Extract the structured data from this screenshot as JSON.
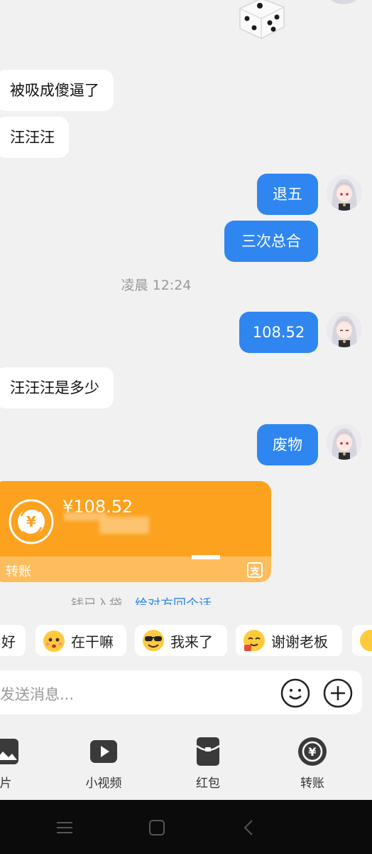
{
  "messages": [
    {
      "side": "left",
      "text": "被吸成傻逼了"
    },
    {
      "side": "left",
      "text": "汪汪汪"
    },
    {
      "side": "right",
      "text": "退五"
    },
    {
      "side": "right",
      "text": "三次总合"
    },
    {
      "side": "right",
      "text": "108.52"
    },
    {
      "side": "left",
      "text": "汪汪汪是多少"
    },
    {
      "side": "right",
      "text": "废物"
    }
  ],
  "timestamp": "凌晨 12:24",
  "transfer": {
    "amount": "¥108.52",
    "label": "转账",
    "received_text": "钱已入袋",
    "received_link": "给对方回个话"
  },
  "quick_replies": [
    {
      "label": "好",
      "icon": "emoji-icon"
    },
    {
      "label": "在干嘛",
      "icon": "curious-emoji-icon"
    },
    {
      "label": "我来了",
      "icon": "sunglasses-emoji-icon"
    },
    {
      "label": "谢谢老板",
      "icon": "thanks-emoji-icon"
    }
  ],
  "input": {
    "placeholder": "发送消息..."
  },
  "toolbar": [
    {
      "label": "片",
      "icon": "image-icon"
    },
    {
      "label": "小视频",
      "icon": "video-icon"
    },
    {
      "label": "红包",
      "icon": "red-packet-icon"
    },
    {
      "label": "转账",
      "icon": "transfer-icon"
    }
  ],
  "colors": {
    "sent_bubble": "#2f86f0",
    "received_bubble": "#ffffff",
    "transfer_card": "#fca21f",
    "background": "#f1f1f1"
  }
}
